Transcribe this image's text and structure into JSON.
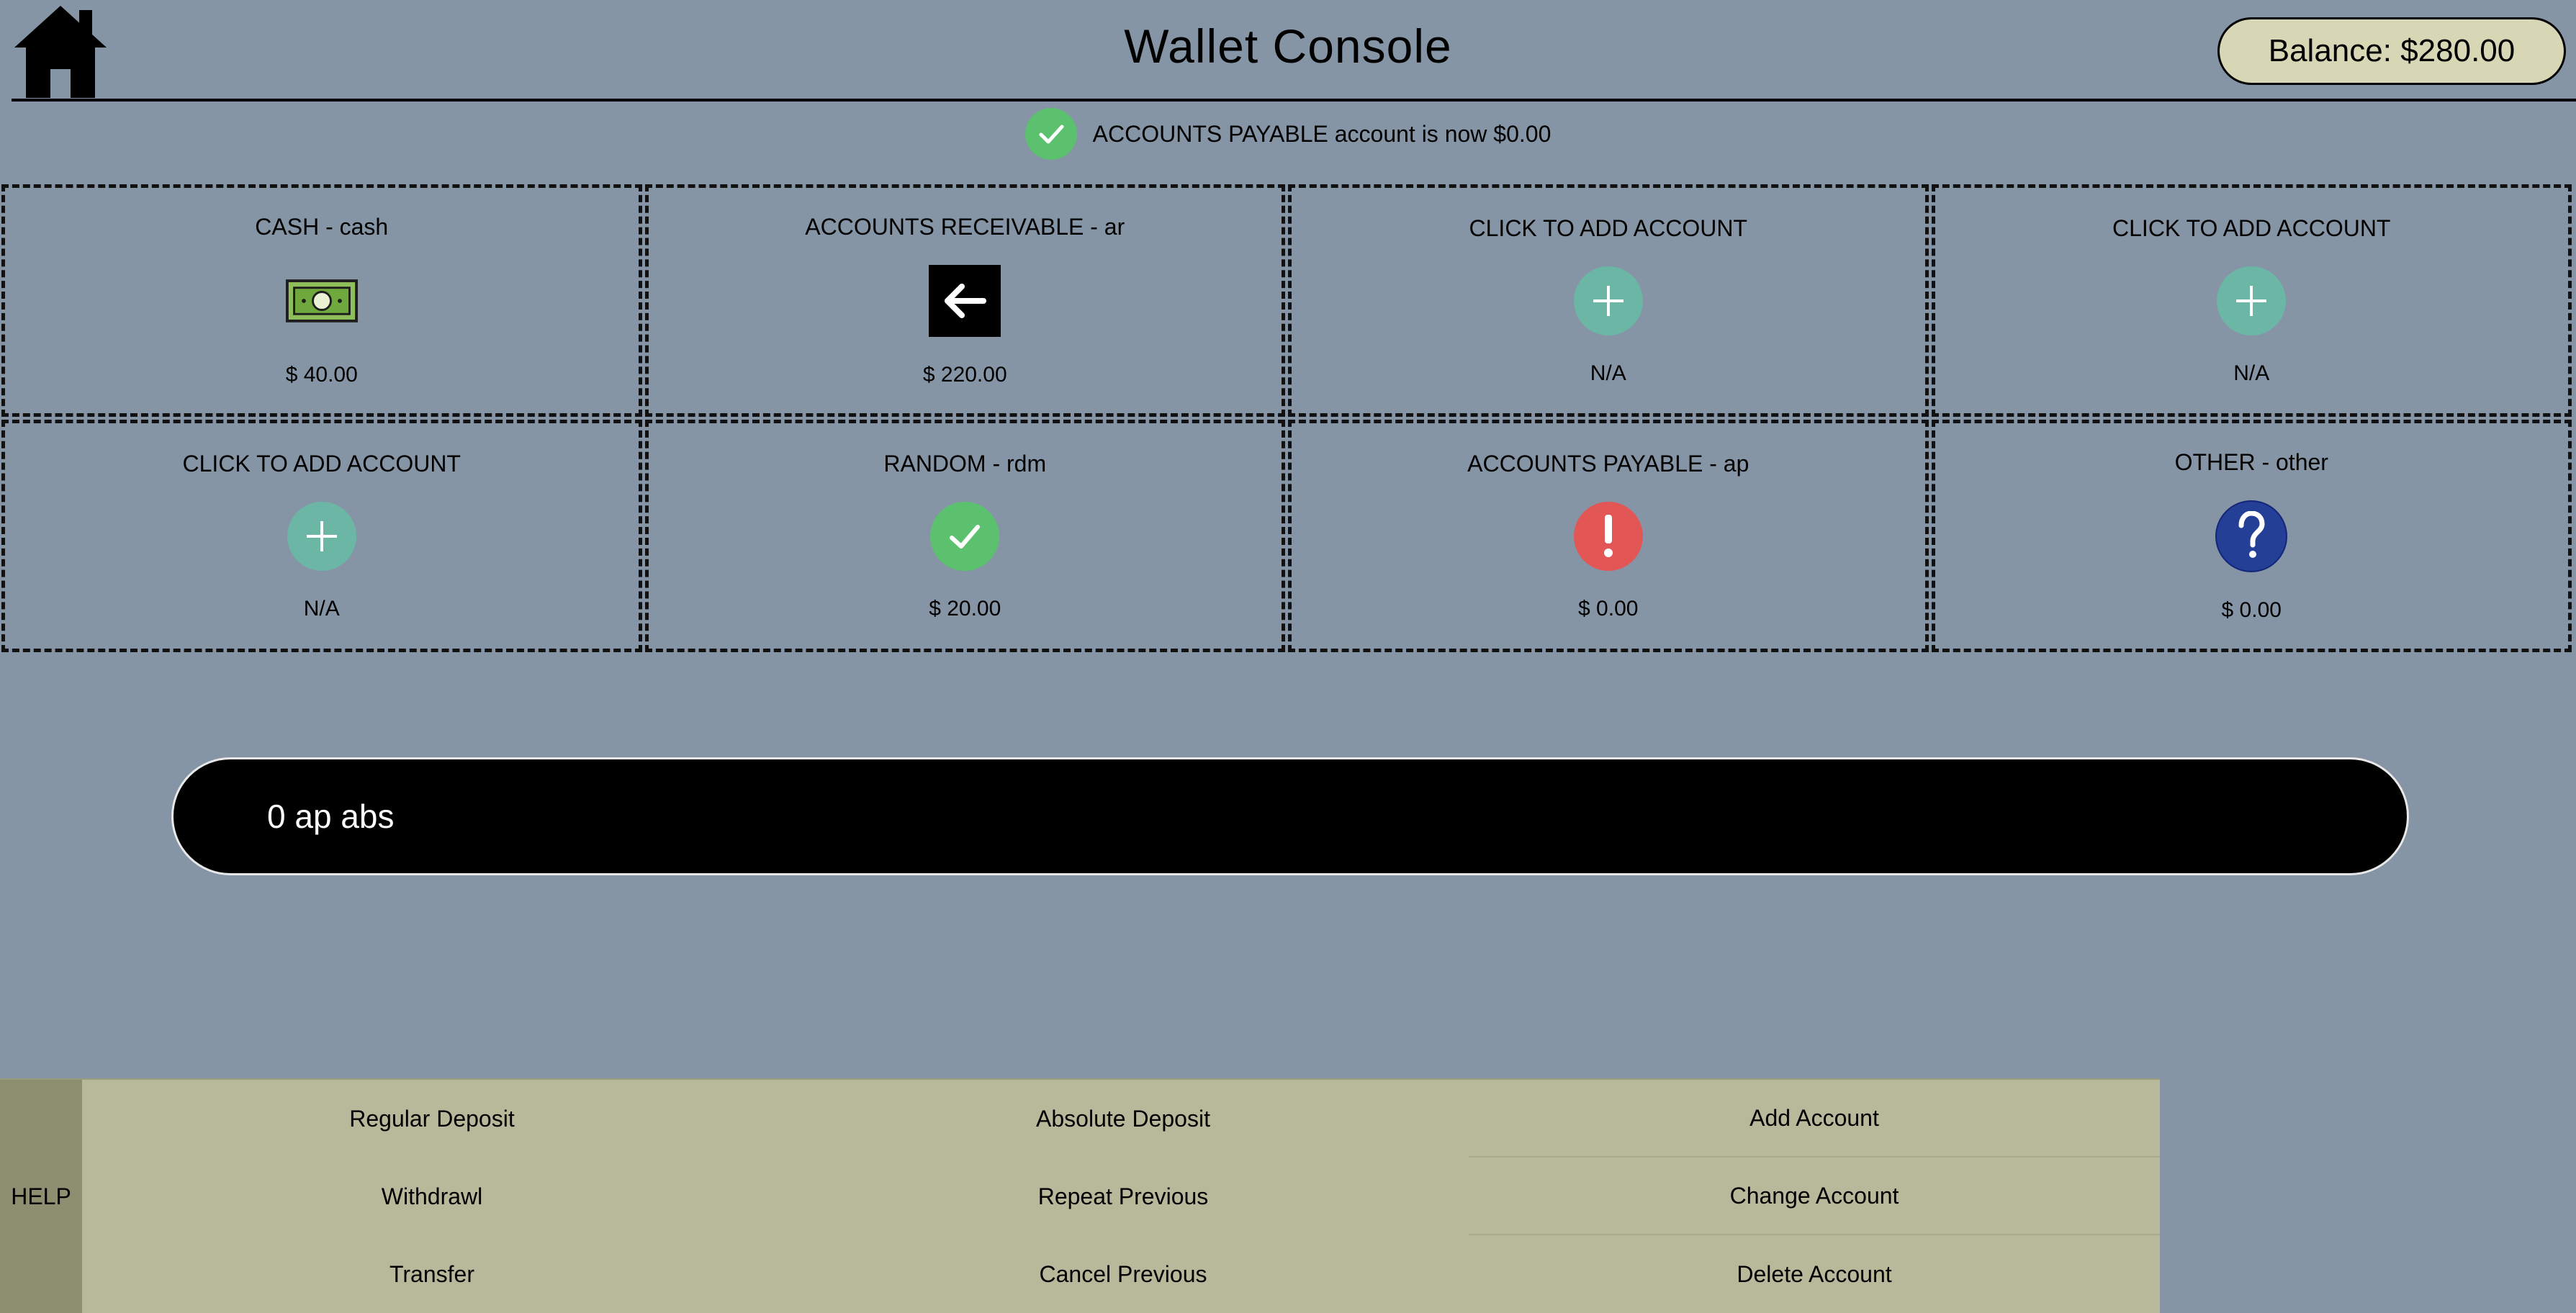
{
  "header": {
    "title": "Wallet Console",
    "balance": "Balance: $280.00"
  },
  "notification": {
    "text": "ACCOUNTS PAYABLE account is now $0.00",
    "icon": "check-circle-icon"
  },
  "accounts": [
    {
      "name": "CASH - cash",
      "balance": "$ 40.00",
      "icon": "cash-icon"
    },
    {
      "name": "ACCOUNTS RECEIVABLE - ar",
      "balance": "$ 220.00",
      "icon": "arrow-left-icon"
    },
    {
      "name": "CLICK TO ADD ACCOUNT",
      "balance": "N/A",
      "icon": "plus-icon"
    },
    {
      "name": "CLICK TO ADD ACCOUNT",
      "balance": "N/A",
      "icon": "plus-icon"
    },
    {
      "name": "CLICK TO ADD ACCOUNT",
      "balance": "N/A",
      "icon": "plus-icon"
    },
    {
      "name": "RANDOM - rdm",
      "balance": "$ 20.00",
      "icon": "check-icon"
    },
    {
      "name": "ACCOUNTS PAYABLE - ap",
      "balance": "$ 0.00",
      "icon": "exclamation-icon"
    },
    {
      "name": "OTHER - other",
      "balance": "$ 0.00",
      "icon": "question-icon"
    }
  ],
  "command": {
    "value": "0 ap abs"
  },
  "panel": {
    "help": "HELP",
    "actions": [
      "Regular Deposit",
      "Absolute Deposit",
      "Add Account",
      "Withdrawl",
      "Repeat Previous",
      "Change Account",
      "Transfer",
      "Cancel Previous",
      "Delete Account"
    ]
  },
  "colors": {
    "background": "#8595a6",
    "panel": "#b8b99a",
    "help_button": "#8e8f70",
    "balance_pill": "#d7d6b5",
    "success_green": "#5cc16e",
    "add_teal": "#6cb6a6",
    "alert_red": "#e25656",
    "question_blue": "#233f96"
  }
}
